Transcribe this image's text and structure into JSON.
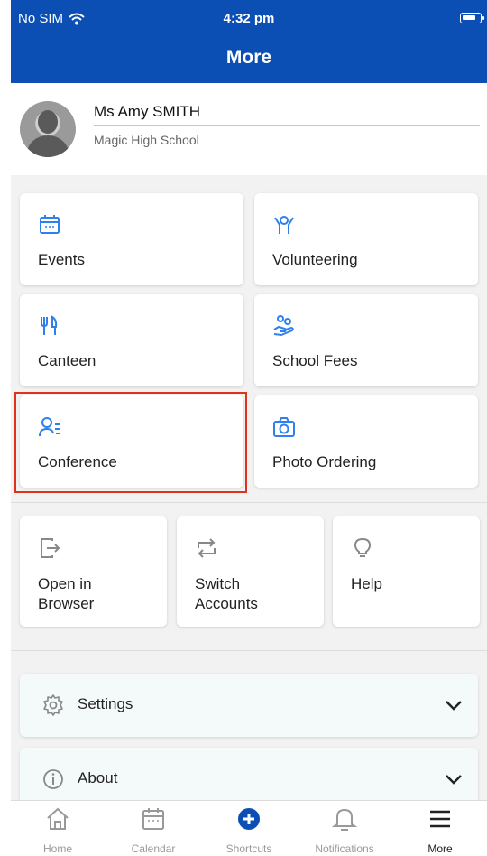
{
  "status_bar": {
    "carrier": "No SIM",
    "time": "4:32 pm"
  },
  "header": {
    "title": "More"
  },
  "profile": {
    "name": "Ms Amy SMITH",
    "school": "Magic High School"
  },
  "grid": [
    {
      "label": "Events",
      "icon": "calendar-icon"
    },
    {
      "label": "Volunteering",
      "icon": "volunteer-icon"
    },
    {
      "label": "Canteen",
      "icon": "cutlery-icon"
    },
    {
      "label": "School Fees",
      "icon": "hand-coins-icon"
    },
    {
      "label": "Conference",
      "icon": "person-list-icon"
    },
    {
      "label": "Photo Ordering",
      "icon": "camera-icon"
    }
  ],
  "utilities": [
    {
      "label_line1": "Open in",
      "label_line2": "Browser",
      "icon": "open-external-icon"
    },
    {
      "label_line1": "Switch",
      "label_line2": "Accounts",
      "icon": "swap-icon"
    },
    {
      "label_line1": "Help",
      "label_line2": "",
      "icon": "lightbulb-icon"
    }
  ],
  "accordion": [
    {
      "label": "Settings",
      "icon": "gear-icon"
    },
    {
      "label": "About",
      "icon": "info-icon"
    }
  ],
  "tabs": [
    {
      "label": "Home",
      "icon": "home-icon"
    },
    {
      "label": "Calendar",
      "icon": "calendar-icon"
    },
    {
      "label": "Shortcuts",
      "icon": "plus-circle-icon"
    },
    {
      "label": "Notifications",
      "icon": "bell-icon"
    },
    {
      "label": "More",
      "icon": "menu-icon"
    }
  ],
  "colors": {
    "brand_blue": "#0b4fb5",
    "icon_blue": "#2f80ed",
    "highlight_red": "#e0301e",
    "icon_gray": "#888888"
  }
}
